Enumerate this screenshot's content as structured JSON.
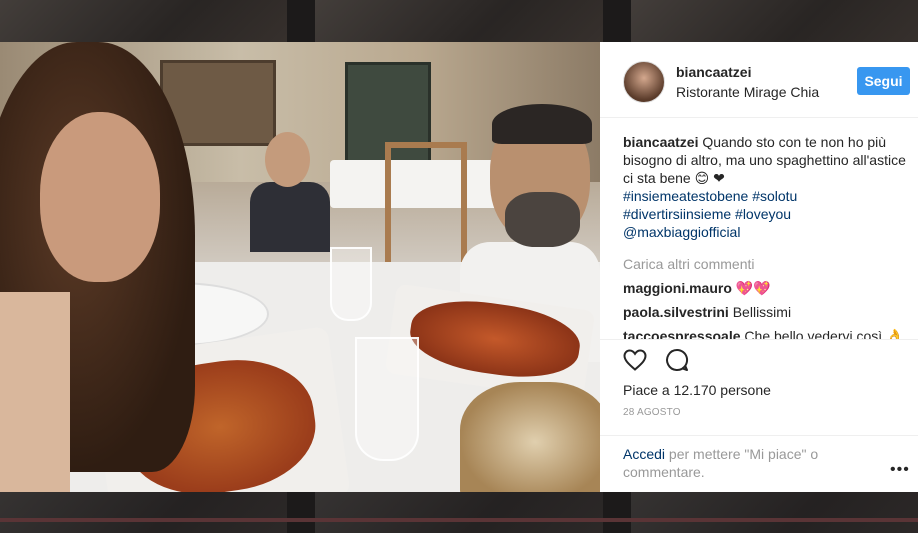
{
  "post": {
    "username": "biancaatzei",
    "location": "Ristorante Mirage Chia",
    "follow_label": "Segui",
    "caption": {
      "username": "biancaatzei",
      "text": "Quando sto con te non ho più bisogno di altro, ma uno spaghettino all'astice ci sta bene 😊 ❤",
      "hashtags_line1": "#insiemeatestobene #solotu",
      "hashtags_line2": "#divertirsiinsieme #loveyou",
      "mention": "@maxbiaggiofficial"
    },
    "load_more": "Carica altri commenti",
    "comments": [
      {
        "username": "maggioni.mauro",
        "text": "💖💖"
      },
      {
        "username": "paola.silvestrini",
        "text": "Bellissimi"
      },
      {
        "username": "taccoespressoale",
        "text": "Che bello vedervi così 👌"
      }
    ],
    "likes": "Piace a 12.170 persone",
    "date": "28 AGOSTO",
    "login_link": "Accedi",
    "login_rest": " per mettere \"Mi piace\" o commentare.",
    "more_glyph": "•••",
    "icons": {
      "like": "heart-icon",
      "comment": "comment-icon"
    }
  }
}
